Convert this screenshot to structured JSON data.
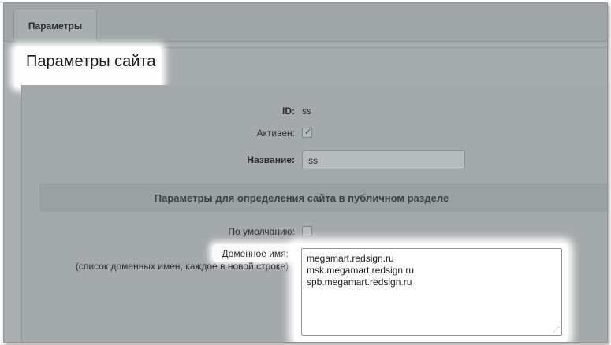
{
  "tabs": [
    {
      "label": "Параметры"
    }
  ],
  "page_title": "Параметры сайта",
  "fields": {
    "id": {
      "label": "ID:",
      "value": "ss"
    },
    "active": {
      "label": "Активен:",
      "checked": true
    },
    "name": {
      "label": "Название:",
      "value": "ss"
    }
  },
  "section": {
    "title": "Параметры для определения сайта в публичном разделе"
  },
  "default_field": {
    "label": "По умолчанию:",
    "checked": false
  },
  "domain": {
    "label": "Доменное имя:",
    "hint": "(список доменных имен, каждое в новой строке)",
    "lines": [
      "megamart.redsign.ru",
      "msk.megamart.redsign.ru",
      "spb.megamart.redsign.ru"
    ]
  },
  "icons": {
    "check": "checkmark-icon",
    "resize": "resize-grip-icon"
  }
}
